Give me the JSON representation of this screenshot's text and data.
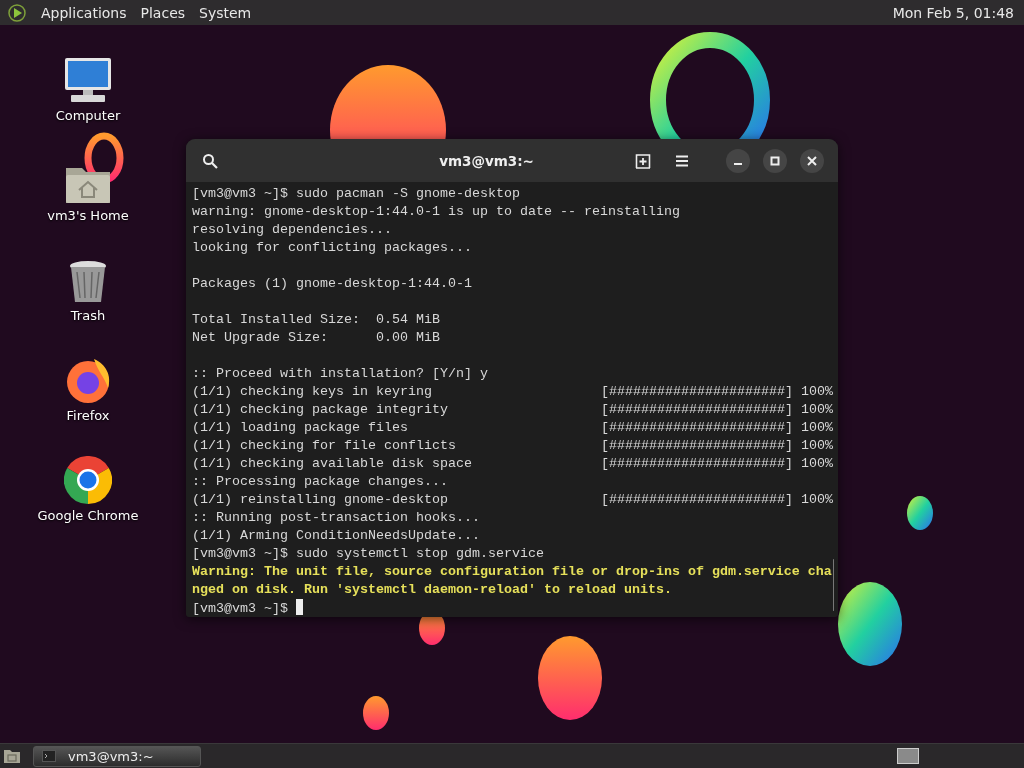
{
  "top_panel": {
    "menus": [
      "Applications",
      "Places",
      "System"
    ],
    "clock": "Mon Feb 5, 01:48"
  },
  "desktop_icons": [
    {
      "kind": "computer",
      "label": "Computer"
    },
    {
      "kind": "home",
      "label": "vm3's Home"
    },
    {
      "kind": "trash",
      "label": "Trash"
    },
    {
      "kind": "firefox",
      "label": "Firefox"
    },
    {
      "kind": "chrome",
      "label": "Google Chrome"
    }
  ],
  "terminal": {
    "title": "vm3@vm3:~",
    "lines": [
      {
        "kind": "command",
        "prompt": "[vm3@vm3 ~]$",
        "text": "sudo pacman -S gnome-desktop"
      },
      {
        "kind": "output",
        "text": "warning: gnome-desktop-1:44.0-1 is up to date -- reinstalling"
      },
      {
        "kind": "output",
        "text": "resolving dependencies..."
      },
      {
        "kind": "output",
        "text": "looking for conflicting packages..."
      },
      {
        "kind": "blank"
      },
      {
        "kind": "output",
        "text": "Packages (1) gnome-desktop-1:44.0-1"
      },
      {
        "kind": "blank"
      },
      {
        "kind": "output",
        "text": "Total Installed Size:  0.54 MiB"
      },
      {
        "kind": "output",
        "text": "Net Upgrade Size:      0.00 MiB"
      },
      {
        "kind": "blank"
      },
      {
        "kind": "output",
        "text": ":: Proceed with installation? [Y/n] y"
      },
      {
        "kind": "progress",
        "text": "(1/1) checking keys in keyring",
        "bar": "[######################]",
        "percent": "100%"
      },
      {
        "kind": "progress",
        "text": "(1/1) checking package integrity",
        "bar": "[######################]",
        "percent": "100%"
      },
      {
        "kind": "progress",
        "text": "(1/1) loading package files",
        "bar": "[######################]",
        "percent": "100%"
      },
      {
        "kind": "progress",
        "text": "(1/1) checking for file conflicts",
        "bar": "[######################]",
        "percent": "100%"
      },
      {
        "kind": "progress",
        "text": "(1/1) checking available disk space",
        "bar": "[######################]",
        "percent": "100%"
      },
      {
        "kind": "output",
        "text": ":: Processing package changes..."
      },
      {
        "kind": "progress",
        "text": "(1/1) reinstalling gnome-desktop",
        "bar": "[######################]",
        "percent": "100%"
      },
      {
        "kind": "output",
        "text": ":: Running post-transaction hooks..."
      },
      {
        "kind": "output",
        "text": "(1/1) Arming ConditionNeedsUpdate..."
      },
      {
        "kind": "command",
        "prompt": "[vm3@vm3 ~]$",
        "text": "sudo systemctl stop gdm.service"
      },
      {
        "kind": "warning",
        "text": "Warning: The unit file, source configuration file or drop-ins of gdm.service cha"
      },
      {
        "kind": "warning",
        "text": "nged on disk. Run 'systemctl daemon-reload' to reload units."
      },
      {
        "kind": "cursor",
        "prompt": "[vm3@vm3 ~]$"
      }
    ]
  },
  "taskbar": {
    "tasks": [
      {
        "label": "vm3@vm3:~",
        "selected": true
      }
    ]
  }
}
